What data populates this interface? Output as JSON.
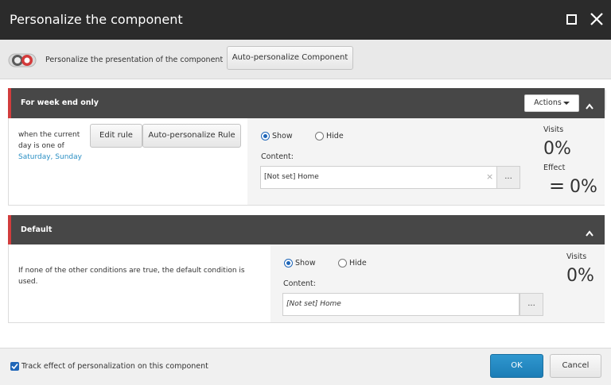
{
  "dialog": {
    "title": "Personalize the component"
  },
  "toolbar": {
    "label": "Personalize the presentation of the component",
    "auto_personalize_component": "Auto-personalize Component"
  },
  "rules": [
    {
      "name": "For week end only",
      "actions_label": "Actions",
      "condition_prefix": "when the current day is one of",
      "condition_value": "Saturday, Sunday",
      "edit_rule_label": "Edit rule",
      "auto_personalize_rule_label": "Auto-personalize Rule",
      "show_label": "Show",
      "hide_label": "Hide",
      "selected": "Show",
      "content_label": "Content:",
      "content_value": "[Not set] Home",
      "clear_glyph": "×",
      "browse_label": "...",
      "visits_label": "Visits",
      "visits_value": "0%",
      "effect_label": "Effect",
      "effect_symbol": "=",
      "effect_value": "0%"
    },
    {
      "name": "Default",
      "condition_text": "If none of the other conditions are true, the default condition is used.",
      "show_label": "Show",
      "hide_label": "Hide",
      "selected": "Show",
      "content_label": "Content:",
      "content_value": "[Not set] Home",
      "browse_label": "...",
      "visits_label": "Visits",
      "visits_value": "0%"
    }
  ],
  "footer": {
    "track_label": "Track effect of personalization on this component",
    "track_checked": true,
    "ok_label": "OK",
    "cancel_label": "Cancel"
  },
  "icons": [
    "maximize-icon",
    "close-icon",
    "personalize-toggle-icon",
    "add-icon",
    "chevron-up-icon",
    "caret-down-icon",
    "check-icon"
  ],
  "colors": {
    "titlebar": "#2b2b2b",
    "section_header": "#474747",
    "accent_red": "#d23c3c",
    "link": "#2a8fc4",
    "primary_button": "#2088c0",
    "plus_icon": "#3a86c8"
  }
}
